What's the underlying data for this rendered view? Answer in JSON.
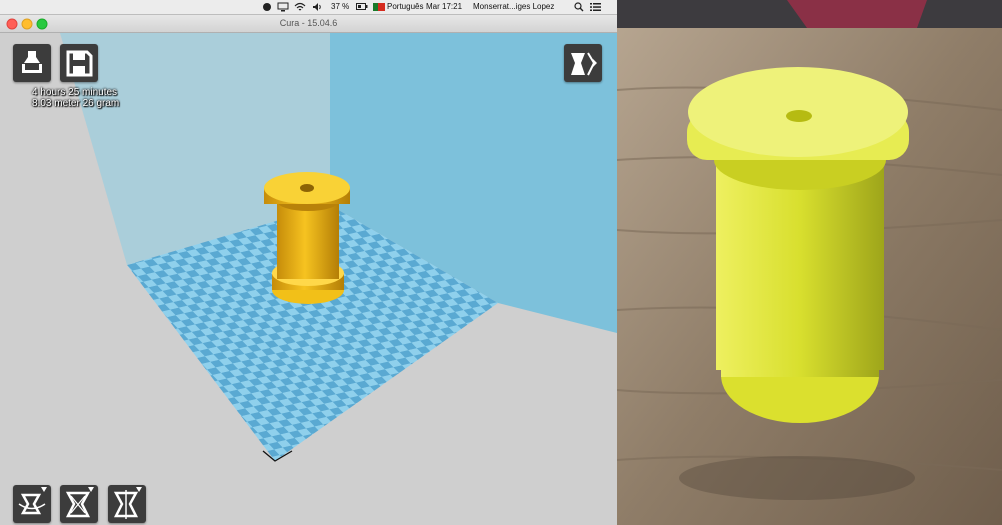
{
  "menubar": {
    "battery": "37 %",
    "language": "Português",
    "clock": "Mar 17:21",
    "user": "Monserrat...iges Lopez"
  },
  "window": {
    "title": "Cura - 15.04.6"
  },
  "toolbar": {
    "load_icon": "load-model-icon",
    "save_icon": "save-gcode-icon",
    "view_mode_icon": "view-mode-icon"
  },
  "print_info": {
    "time": "4 hours 25 minutes",
    "material": "8.03 meter 26 gram"
  },
  "bottom_tools": [
    "rotate-icon",
    "scale-icon",
    "mirror-icon"
  ],
  "colors": {
    "build_plate_light": "#8fd0ec",
    "build_plate_dark": "#5aa9d2",
    "walls": "#8ccde4",
    "model": "#f2c018",
    "background": "#cfcfcf",
    "button": "#3c3c3c",
    "printed_object": "#dde63a"
  }
}
